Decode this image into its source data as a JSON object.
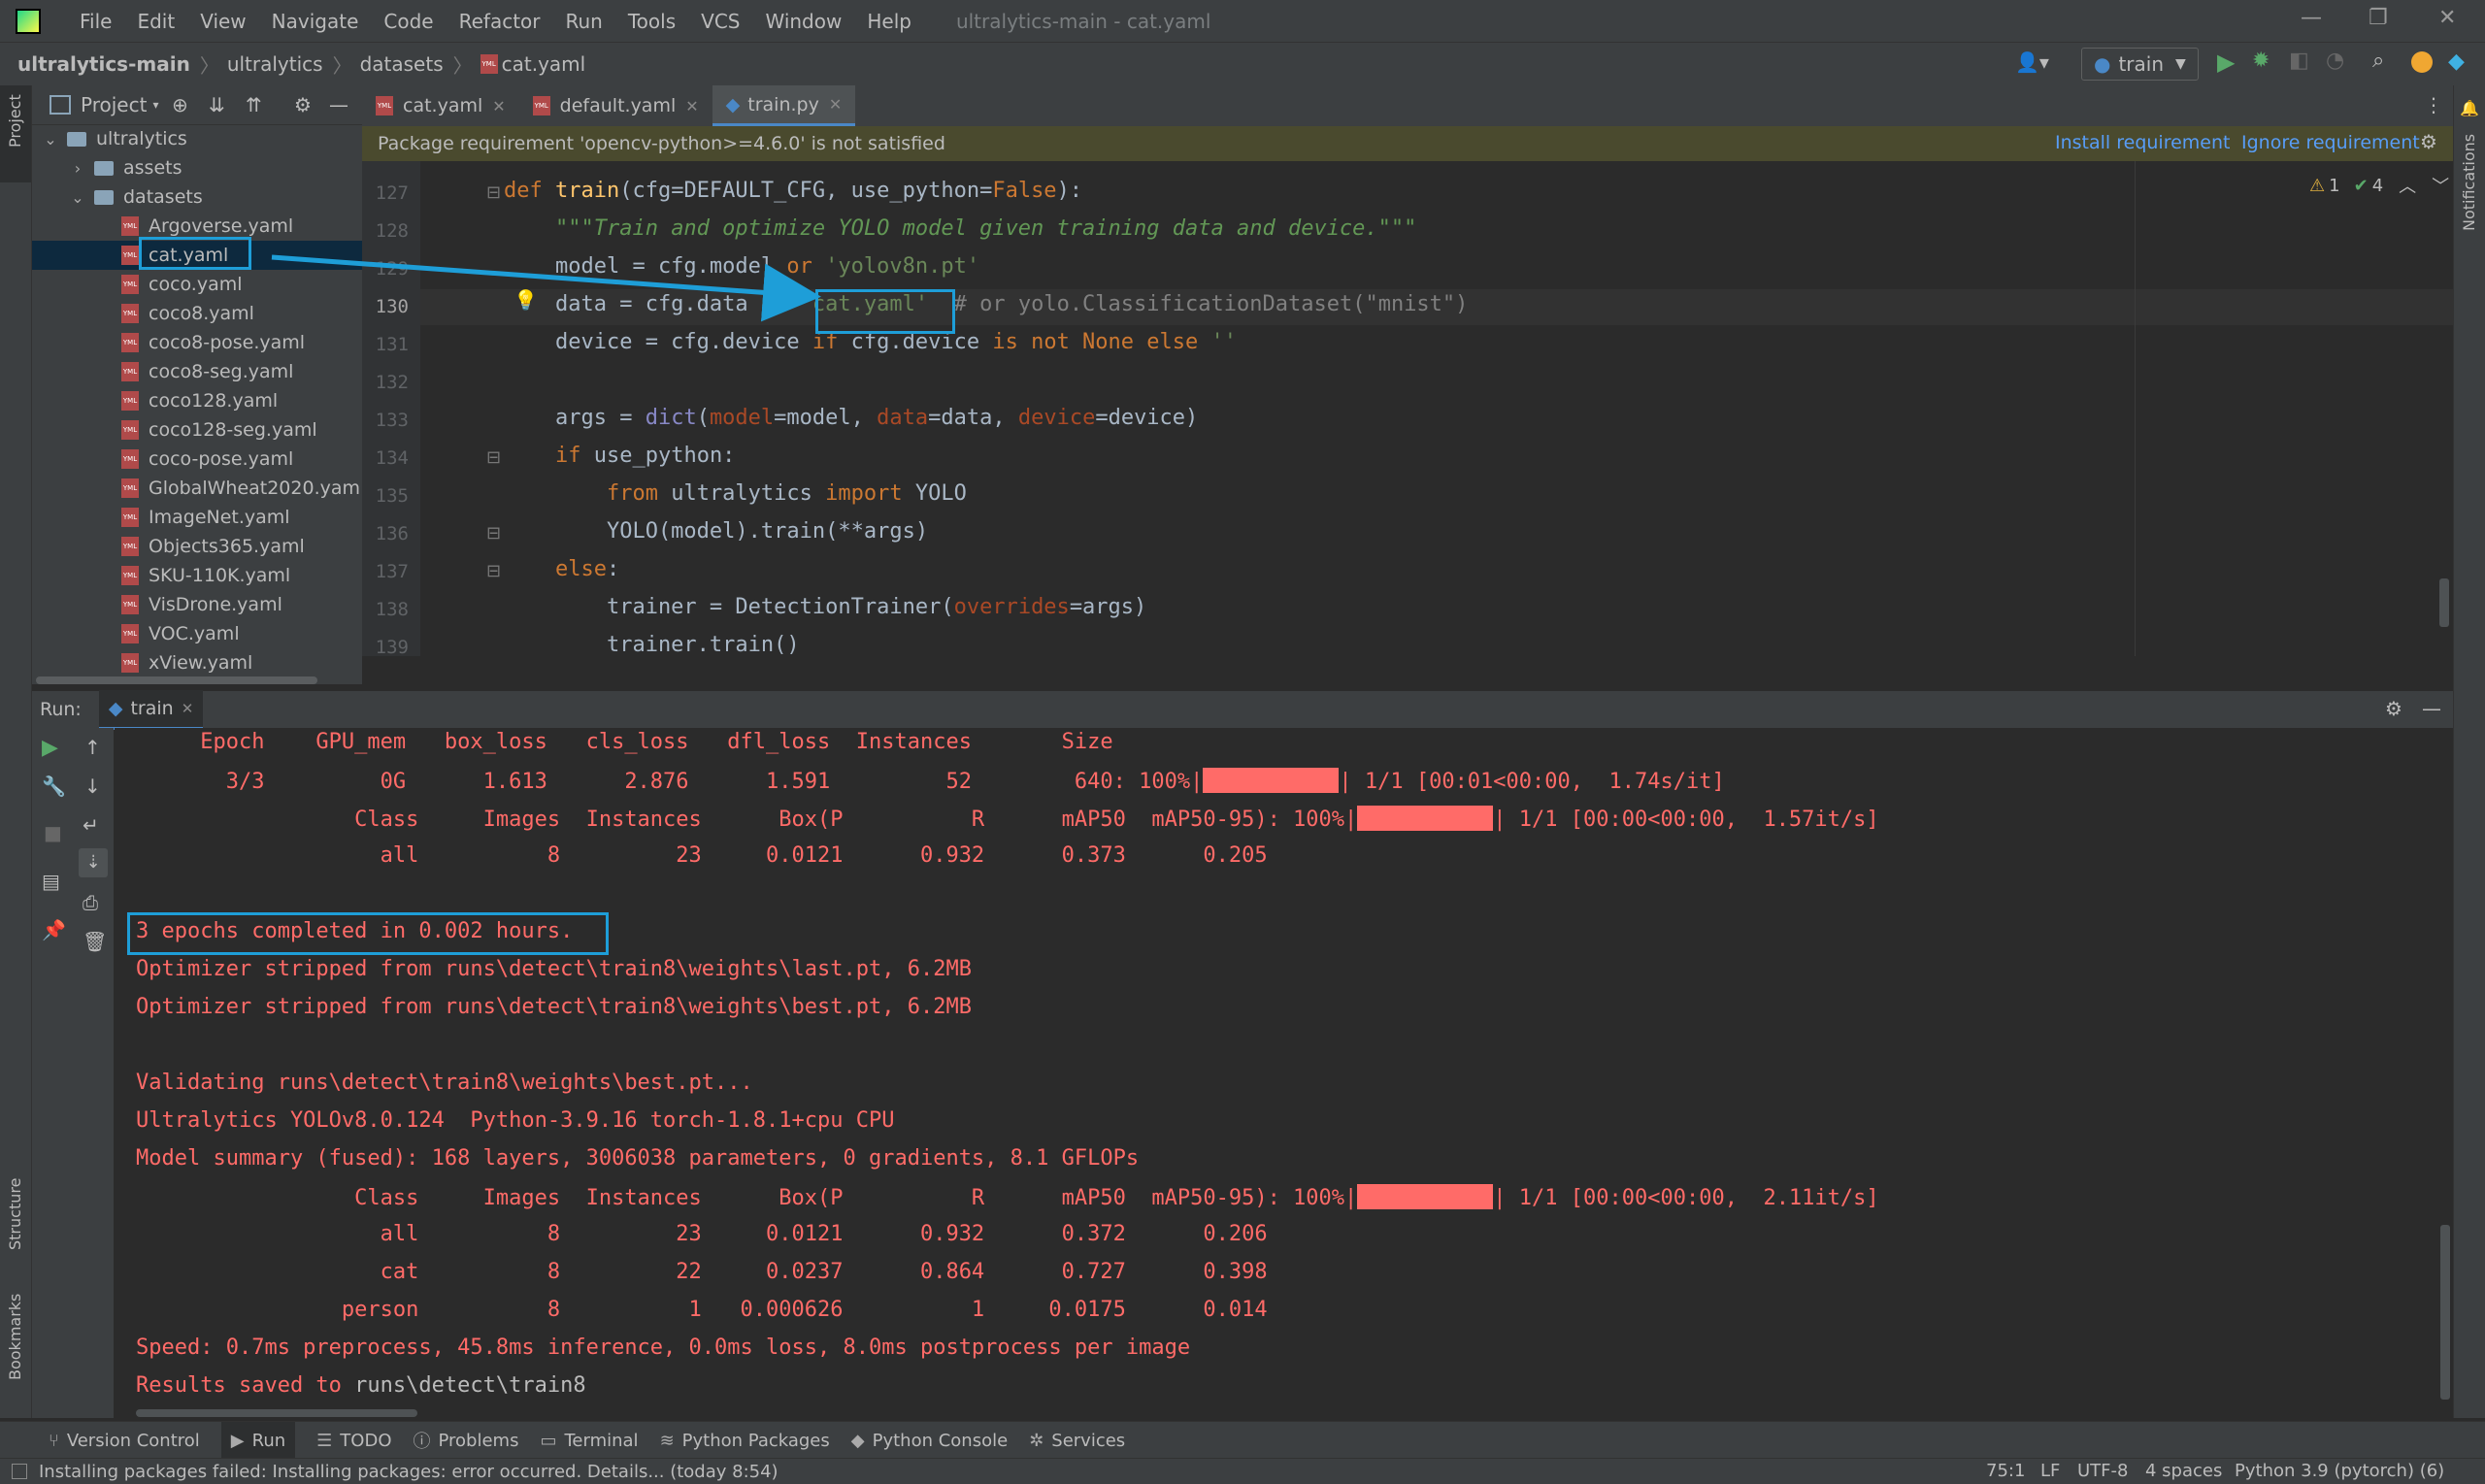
{
  "window": {
    "title": "ultralytics-main - cat.yaml"
  },
  "menu": [
    "File",
    "Edit",
    "View",
    "Navigate",
    "Code",
    "Refactor",
    "Run",
    "Tools",
    "VCS",
    "Window",
    "Help"
  ],
  "breadcrumb": [
    "ultralytics-main",
    "ultralytics",
    "datasets",
    "cat.yaml"
  ],
  "run_config": "train",
  "project_panel": {
    "title": "Project",
    "tree": [
      {
        "label": "ultralytics",
        "kind": "folder",
        "expanded": true
      },
      {
        "label": "assets",
        "kind": "folder",
        "expanded": false
      },
      {
        "label": "datasets",
        "kind": "folder",
        "expanded": true
      },
      {
        "label": "Argoverse.yaml",
        "kind": "yaml"
      },
      {
        "label": "cat.yaml",
        "kind": "yaml",
        "selected": true
      },
      {
        "label": "coco.yaml",
        "kind": "yaml"
      },
      {
        "label": "coco8.yaml",
        "kind": "yaml"
      },
      {
        "label": "coco8-pose.yaml",
        "kind": "yaml"
      },
      {
        "label": "coco8-seg.yaml",
        "kind": "yaml"
      },
      {
        "label": "coco128.yaml",
        "kind": "yaml"
      },
      {
        "label": "coco128-seg.yaml",
        "kind": "yaml"
      },
      {
        "label": "coco-pose.yaml",
        "kind": "yaml"
      },
      {
        "label": "GlobalWheat2020.yam",
        "kind": "yaml"
      },
      {
        "label": "ImageNet.yaml",
        "kind": "yaml"
      },
      {
        "label": "Objects365.yaml",
        "kind": "yaml"
      },
      {
        "label": "SKU-110K.yaml",
        "kind": "yaml"
      },
      {
        "label": "VisDrone.yaml",
        "kind": "yaml"
      },
      {
        "label": "VOC.yaml",
        "kind": "yaml"
      },
      {
        "label": "xView.yaml",
        "kind": "yaml"
      }
    ]
  },
  "tabs": [
    {
      "label": "cat.yaml",
      "active": false
    },
    {
      "label": "default.yaml",
      "active": false
    },
    {
      "label": "train.py",
      "active": true
    }
  ],
  "warning": {
    "text": "Package requirement 'opencv-python>=4.6.0' is not satisfied",
    "install": "Install requirement",
    "ignore": "Ignore requirement"
  },
  "inspections": {
    "warnings": "1",
    "ok": "4"
  },
  "editor": {
    "line_numbers": [
      "127",
      "128",
      "129",
      "130",
      "131",
      "132",
      "133",
      "134",
      "135",
      "136",
      "137",
      "138",
      "139"
    ],
    "current_line": "130"
  },
  "run_panel": {
    "label": "Run:",
    "tab": "train"
  },
  "console": {
    "line1": "     Epoch    GPU_mem   box_loss   cls_loss   dfl_loss  Instances       Size",
    "line2a": "       3/3         0G      1.613      2.876      1.591         52        640: 100%|",
    "line2b": "| 1/1 [00:01<00:00,  1.74s/it]",
    "line3a": "                 Class     Images  Instances      Box(P          R      mAP50  mAP50-95): 100%|",
    "line3b": "| 1/1 [00:00<00:00,  1.57it/s]",
    "line4": "                   all          8         23     0.0121      0.932      0.373      0.205",
    "line5": "3 epochs completed in 0.002 hours.",
    "line6": "Optimizer stripped from runs\\detect\\train8\\weights\\last.pt, 6.2MB",
    "line7": "Optimizer stripped from runs\\detect\\train8\\weights\\best.pt, 6.2MB",
    "line8": "Validating runs\\detect\\train8\\weights\\best.pt...",
    "line9": "Ultralytics YOLOv8.0.124  Python-3.9.16 torch-1.8.1+cpu CPU",
    "line10": "Model summary (fused): 168 layers, 3006038 parameters, 0 gradients, 8.1 GFLOPs",
    "line11a": "                 Class     Images  Instances      Box(P          R      mAP50  mAP50-95): 100%|",
    "line11b": "| 1/1 [00:00<00:00,  2.11it/s]",
    "line12": "                   all          8         23     0.0121      0.932      0.372      0.206",
    "line13": "                   cat          8         22     0.0237      0.864      0.727      0.398",
    "line14": "                person          8          1   0.000626          1     0.0175      0.014",
    "line15": "Speed: 0.7ms preprocess, 45.8ms inference, 0.0ms loss, 8.0ms postprocess per image",
    "line16a": "Results saved to ",
    "line16b": "runs\\detect\\train8",
    "progress_fraction": 1.0
  },
  "tool_windows": [
    "Version Control",
    "Run",
    "TODO",
    "Problems",
    "Terminal",
    "Python Packages",
    "Python Console",
    "Services"
  ],
  "left_strip": [
    "Project",
    "Structure",
    "Bookmarks"
  ],
  "right_strip": [
    "Notifications"
  ],
  "status": {
    "message": "Installing packages failed: Installing packages: error occurred. Details... (today 8:54)",
    "position": "75:1",
    "line_sep": "LF",
    "encoding": "UTF-8",
    "indent": "4 spaces",
    "interpreter": "Python 3.9 (pytorch) (6)"
  },
  "colors": {
    "accent": "#1e9ed8",
    "error_text": "#ff6b68",
    "bg": "#2b2b2b"
  }
}
